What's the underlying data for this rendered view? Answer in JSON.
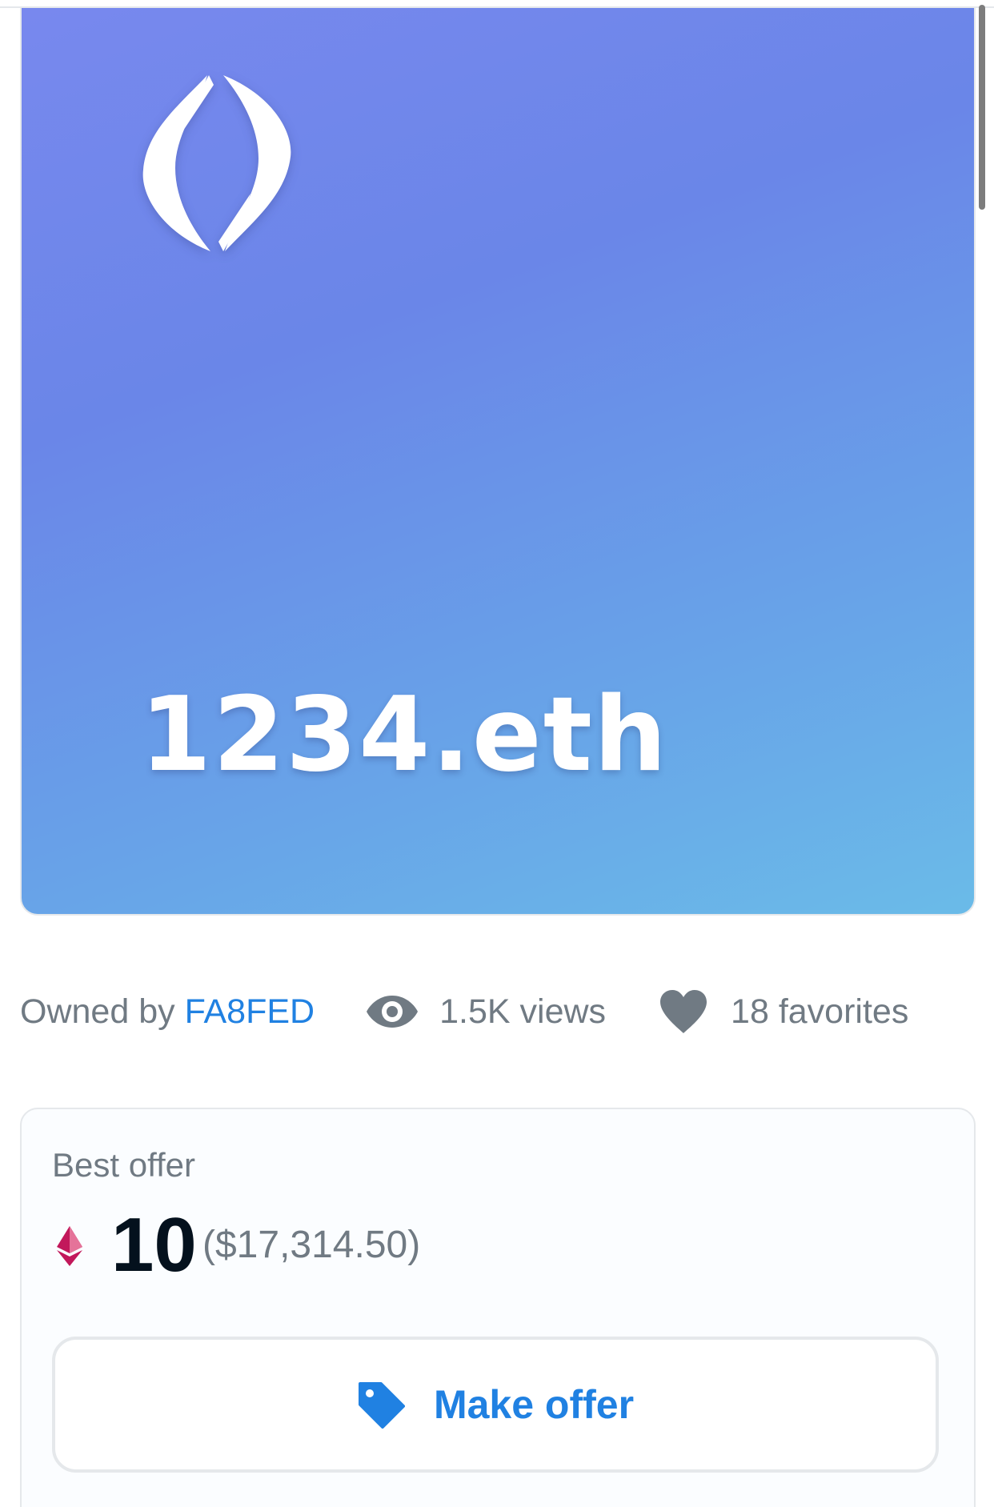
{
  "nft": {
    "name": "1234.eth",
    "logo_icon": "ens-logo"
  },
  "meta": {
    "owned_by_prefix": "Owned by",
    "owner": "FA8FED",
    "views": "1.5K views",
    "favorites": "18 favorites",
    "views_icon": "eye-icon",
    "favorites_icon": "heart-icon"
  },
  "offer": {
    "label": "Best offer",
    "currency_icon": "ethereum-icon",
    "amount": "10",
    "usd": "($17,314.50)",
    "button_label": "Make offer",
    "button_icon": "tag-icon"
  },
  "colors": {
    "accent": "#2081e2",
    "muted_text": "#707a83",
    "primary_text": "#04111d",
    "border": "#e5e8eb"
  }
}
